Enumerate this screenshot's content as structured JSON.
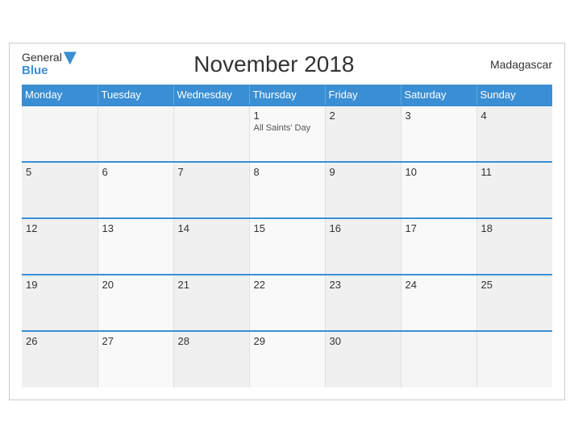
{
  "header": {
    "logo_general": "General",
    "logo_blue": "Blue",
    "title": "November 2018",
    "country": "Madagascar"
  },
  "days_of_week": [
    "Monday",
    "Tuesday",
    "Wednesday",
    "Thursday",
    "Friday",
    "Saturday",
    "Sunday"
  ],
  "weeks": [
    [
      {
        "num": "",
        "event": ""
      },
      {
        "num": "",
        "event": ""
      },
      {
        "num": "",
        "event": ""
      },
      {
        "num": "1",
        "event": "All Saints' Day"
      },
      {
        "num": "2",
        "event": ""
      },
      {
        "num": "3",
        "event": ""
      },
      {
        "num": "4",
        "event": ""
      }
    ],
    [
      {
        "num": "5",
        "event": ""
      },
      {
        "num": "6",
        "event": ""
      },
      {
        "num": "7",
        "event": ""
      },
      {
        "num": "8",
        "event": ""
      },
      {
        "num": "9",
        "event": ""
      },
      {
        "num": "10",
        "event": ""
      },
      {
        "num": "11",
        "event": ""
      }
    ],
    [
      {
        "num": "12",
        "event": ""
      },
      {
        "num": "13",
        "event": ""
      },
      {
        "num": "14",
        "event": ""
      },
      {
        "num": "15",
        "event": ""
      },
      {
        "num": "16",
        "event": ""
      },
      {
        "num": "17",
        "event": ""
      },
      {
        "num": "18",
        "event": ""
      }
    ],
    [
      {
        "num": "19",
        "event": ""
      },
      {
        "num": "20",
        "event": ""
      },
      {
        "num": "21",
        "event": ""
      },
      {
        "num": "22",
        "event": ""
      },
      {
        "num": "23",
        "event": ""
      },
      {
        "num": "24",
        "event": ""
      },
      {
        "num": "25",
        "event": ""
      }
    ],
    [
      {
        "num": "26",
        "event": ""
      },
      {
        "num": "27",
        "event": ""
      },
      {
        "num": "28",
        "event": ""
      },
      {
        "num": "29",
        "event": ""
      },
      {
        "num": "30",
        "event": ""
      },
      {
        "num": "",
        "event": ""
      },
      {
        "num": "",
        "event": ""
      }
    ]
  ]
}
